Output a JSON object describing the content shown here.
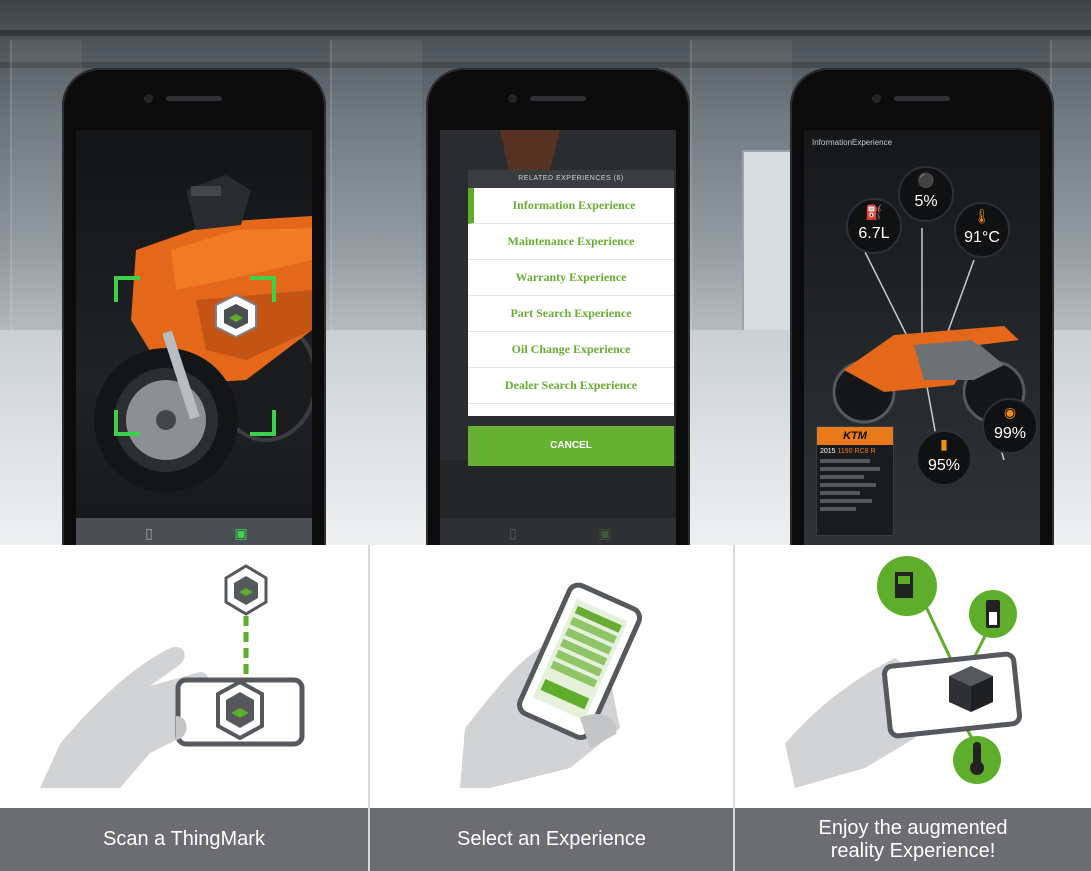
{
  "phone2": {
    "header": "RELATED EXPERIENCES (6)",
    "experiences": [
      {
        "label": "Information Experience",
        "selected": true
      },
      {
        "label": "Maintenance Experience",
        "selected": false
      },
      {
        "label": "Warranty Experience",
        "selected": false
      },
      {
        "label": "Part Search Experience",
        "selected": false
      },
      {
        "label": "Oil Change Experience",
        "selected": false
      },
      {
        "label": "Dealer Search Experience",
        "selected": false
      }
    ],
    "cancel_label": "CANCEL"
  },
  "phone3": {
    "title": "InformationExperience",
    "gauges": {
      "fuel": "6.7L",
      "oil": "5%",
      "temperature": "91°C",
      "battery": "95%",
      "brake": "99%"
    },
    "card": {
      "brand": "KTM",
      "model_year": "2015",
      "model_name": "1190 RC8 R"
    }
  },
  "steps": [
    {
      "caption": "Scan a ThingMark"
    },
    {
      "caption": "Select an Experience"
    },
    {
      "caption": "Enjoy the augmented reality Experience!"
    }
  ],
  "colors": {
    "accent_green": "#66b032",
    "ar_bracket_green": "#3bd14a",
    "gauge_orange": "#f08a1e",
    "caption_gray": "#6b6d70"
  }
}
